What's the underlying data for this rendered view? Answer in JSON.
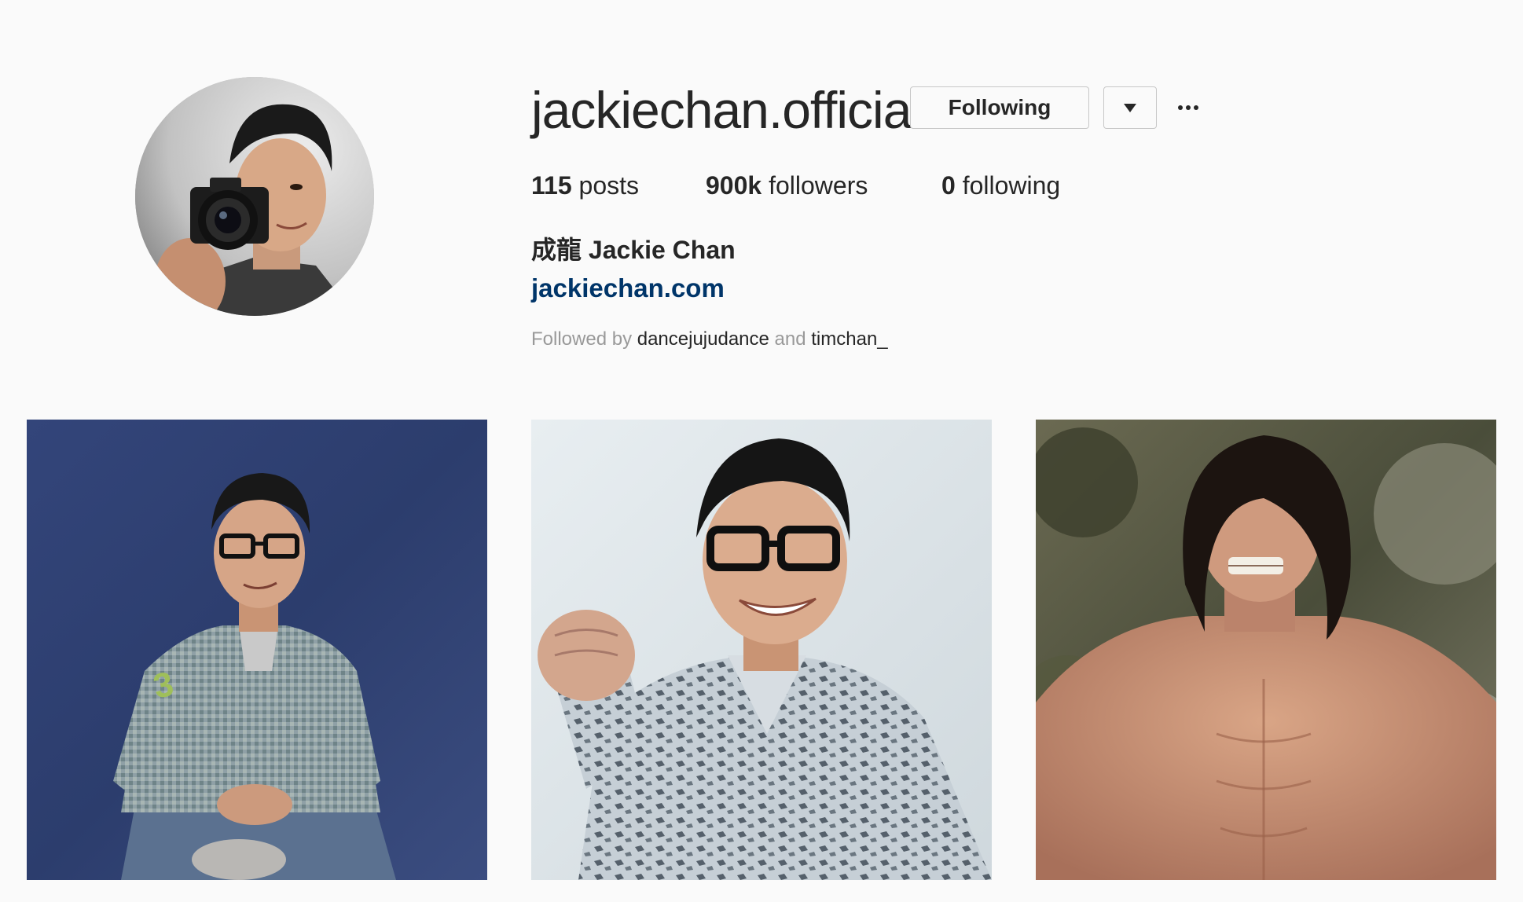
{
  "profile": {
    "username": "jackiechan.official",
    "following_button_label": "Following",
    "dropdown_icon": "caret-down-icon",
    "more_icon": "ellipsis-icon",
    "stats": {
      "posts_count": "115",
      "posts_label": "posts",
      "followers_count": "900k",
      "followers_label": "followers",
      "following_count": "0",
      "following_label": "following"
    },
    "full_name": "成龍 Jackie Chan",
    "website": "jackiechan.com",
    "followed_by": {
      "prefix": "Followed by",
      "account_1": "dancejujudance",
      "connector": "and",
      "account_2": "timchan_"
    }
  },
  "colors": {
    "background": "#fafafa",
    "text": "#262626",
    "link": "#003569",
    "muted": "#999999",
    "button_border": "#c7c7c7"
  },
  "posts": [
    {
      "description_icon": "photo-blue-backdrop"
    },
    {
      "description_icon": "photo-light-backdrop"
    },
    {
      "description_icon": "photo-outdoor-shirtless"
    }
  ]
}
